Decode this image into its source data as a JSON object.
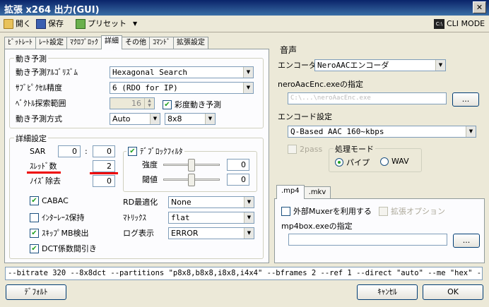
{
  "window": {
    "title": "拡張 x264 出力(GUI)"
  },
  "toolbar": {
    "open": "開く",
    "save": "保存",
    "preset": "プリセット",
    "cli_mode": "CLI MODE"
  },
  "tabs": [
    "ﾋﾞｯﾄﾚｰﾄ",
    "ﾚｰﾄ設定",
    "ﾏｸﾛﾌﾞﾛｯｸ",
    "詳細",
    "その他",
    "ｺﾏﾝﾄﾞ",
    "拡張設定"
  ],
  "motion": {
    "group": "動き予測",
    "algorithm_label": "動き予測ｱﾙｺﾞﾘｽﾞﾑ",
    "algorithm_value": "Hexagonal Search",
    "subpel_label": "ｻﾌﾞﾋﾟｸｾﾙ精度",
    "subpel_value": "6 (RDO for IP)",
    "range_label": "ﾍﾞｸﾄﾙ探索範囲",
    "range_value": "16",
    "chroma_me": "彩度動き予測",
    "method_label": "動き予測方式",
    "method_value": "Auto",
    "partition_value": "8x8"
  },
  "detail": {
    "group": "詳細設定",
    "sar_label": "SAR",
    "sar_w": "0",
    "sar_sep": ":",
    "sar_h": "0",
    "threads_label": "ｽﾚｯﾄﾞ数",
    "threads_value": "2",
    "nr_label": "ﾉｲｽﾞ除去",
    "nr_value": "0",
    "deblock": "ﾃﾞﾌﾞﾛｯｸﾌｨﾙﾀ",
    "strength_label": "強度",
    "strength_value": "0",
    "threshold_label": "閾値",
    "threshold_value": "0",
    "cabac": "CABAC",
    "interlace": "ｲﾝﾀｰﾚｰｽ保持",
    "skip": "ｽｷｯﾌﾟMB検出",
    "dct": "DCT係数間引き",
    "rd_label": "RD最適化",
    "rd_value": "None",
    "matrix_label": "ﾏﾄﾘｯｸｽ",
    "matrix_value": "flat",
    "log_label": "ログ表示",
    "log_value": "ERROR"
  },
  "audio": {
    "title": "音声",
    "encoder_label": "エンコーダ",
    "encoder_value": "NeroAACエンコーダ",
    "exe_label": "neroAacEnc.exeの指定",
    "exe_value": "C:\\...\\neroAacEnc.exe",
    "browse": "...",
    "settings_label": "エンコード設定",
    "settings_value": "Q-Based AAC 160~kbps",
    "twopass": "2pass",
    "mode_group": "処理モード",
    "pipe": "パイプ",
    "wav": "WAV"
  },
  "container": {
    "tabs": [
      ".mp4",
      ".mkv"
    ],
    "external_muxer": "外部Muxerを利用する",
    "ext_option": "拡張オプション",
    "mp4box_label": "mp4box.exeの指定",
    "mp4box_value": "",
    "browse": "..."
  },
  "command_line": "--bitrate 320 --8x8dct --partitions \"p8x8,b8x8,i8x8,i4x4\" --bframes 2 --ref 1 --direct \"auto\" --me \"hex\" --subme 6 --threads 2",
  "buttons": {
    "default": "ﾃﾞﾌｫﾙﾄ",
    "cancel": "ｷｬﾝｾﾙ",
    "ok": "OK"
  },
  "colors": {
    "highlight": "#e00000",
    "titlebar": "#0a246a",
    "check": "#21a121"
  }
}
